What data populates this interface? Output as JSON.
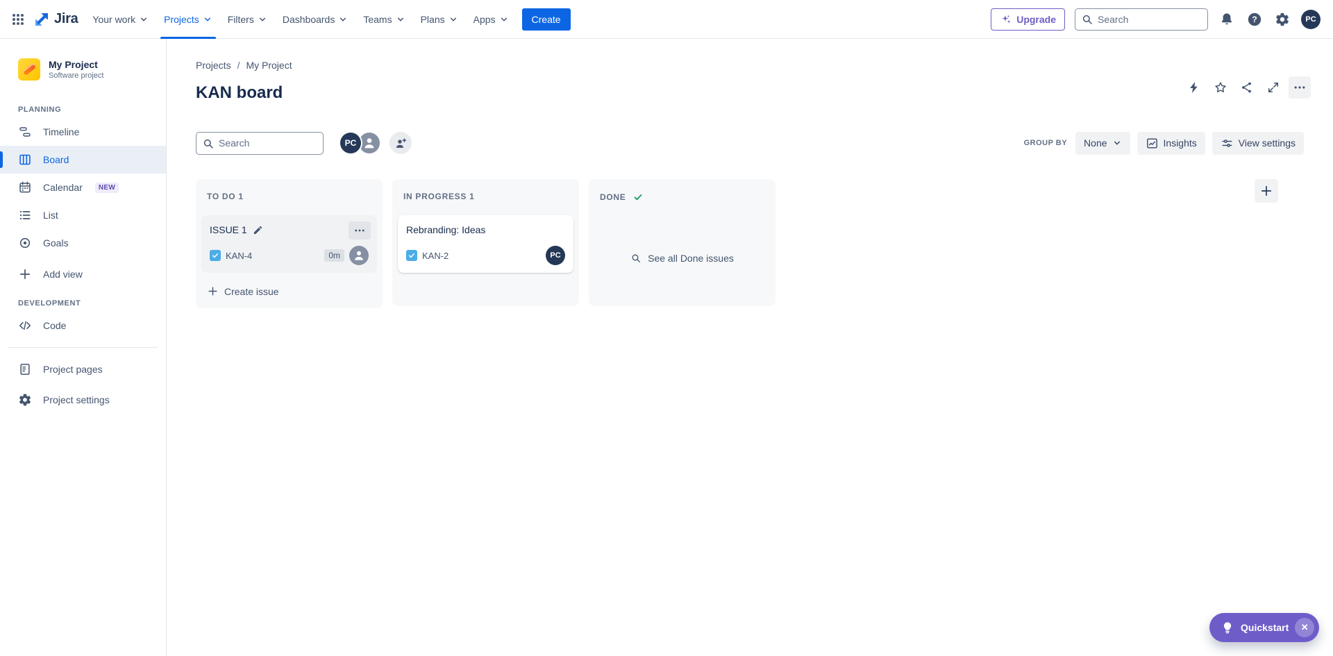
{
  "topnav": {
    "logo": "Jira",
    "items": [
      {
        "label": "Your work"
      },
      {
        "label": "Projects"
      },
      {
        "label": "Filters"
      },
      {
        "label": "Dashboards"
      },
      {
        "label": "Teams"
      },
      {
        "label": "Plans"
      },
      {
        "label": "Apps"
      }
    ],
    "create_label": "Create",
    "upgrade_label": "Upgrade",
    "search_placeholder": "Search",
    "avatar_initials": "PC"
  },
  "sidebar": {
    "project_name": "My Project",
    "project_type": "Software project",
    "planning_label": "PLANNING",
    "development_label": "DEVELOPMENT",
    "items": {
      "timeline": "Timeline",
      "board": "Board",
      "calendar": "Calendar",
      "calendar_badge": "NEW",
      "list": "List",
      "goals": "Goals",
      "add_view": "Add view",
      "code": "Code",
      "project_pages": "Project pages",
      "project_settings": "Project settings"
    }
  },
  "header": {
    "breadcrumb_1": "Projects",
    "breadcrumb_sep": "/",
    "breadcrumb_2": "My Project",
    "title": "KAN board"
  },
  "toolbar": {
    "search_placeholder": "Search",
    "avatar_initials": "PC",
    "group_by_label": "GROUP BY",
    "group_by_value": "None",
    "insights_label": "Insights",
    "view_settings_label": "View settings"
  },
  "board": {
    "columns": [
      {
        "title": "TO DO 1"
      },
      {
        "title": "IN PROGRESS 1"
      },
      {
        "title": "DONE"
      }
    ],
    "cards": [
      {
        "title": "ISSUE 1",
        "key": "KAN-4",
        "estimate": "0m"
      },
      {
        "title": "Rebranding: Ideas",
        "key": "KAN-2",
        "assignee": "PC"
      }
    ],
    "create_issue_label": "Create issue",
    "see_all_done_label": "See all Done issues"
  },
  "quickstart": {
    "label": "Quickstart",
    "close": "✕"
  },
  "colors": {
    "accent_blue": "#0C66E4",
    "upgrade_purple": "#6E5DC6",
    "quickstart_purple": "#6E5DC9",
    "done_green": "#22A06B",
    "task_blue": "#4BADE8",
    "navy_text": "#172B4D"
  }
}
